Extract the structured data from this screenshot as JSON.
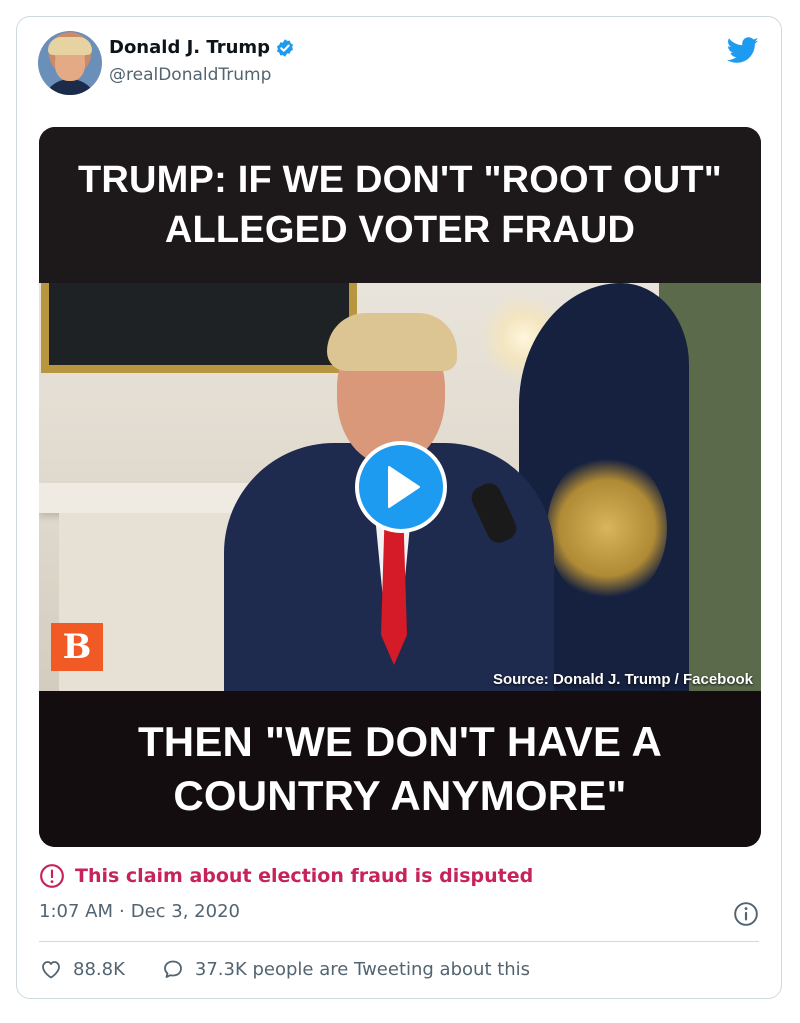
{
  "tweet": {
    "author": {
      "display_name": "Donald J. Trump",
      "handle": "@realDonaldTrump",
      "verified": true
    },
    "media": {
      "type": "video",
      "caption_top": "TRUMP: IF WE DON'T \"ROOT OUT\"\nALLEGED VOTER FRAUD",
      "caption_bottom": "THEN \"WE DON'T HAVE A\nCOUNTRY ANYMORE\"",
      "logo_letter": "B",
      "source": "Source: Donald J. Trump / Facebook"
    },
    "warning": "This claim about election fraud is disputed",
    "time": "1:07 AM",
    "separator": "·",
    "date": "Dec 3, 2020",
    "likes": "88.8K",
    "replies_text": "37.3K people are Tweeting about this"
  },
  "colors": {
    "accent": "#1d9bf0",
    "warning": "#c6235d",
    "text_secondary": "#536471",
    "logo_orange": "#f15a24"
  },
  "icons": {
    "brand": "twitter-bird-icon",
    "verified": "verified-badge-icon",
    "play": "play-icon",
    "warning": "exclamation-circle-icon",
    "info": "info-icon",
    "like": "heart-icon",
    "reply": "speech-bubble-icon"
  }
}
